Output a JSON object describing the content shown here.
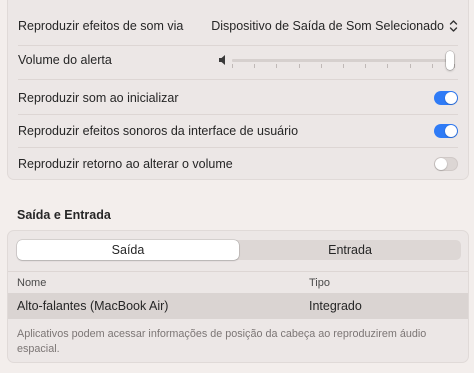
{
  "sound_settings": {
    "play_via_label": "Reproduzir efeitos de som via",
    "play_via_value": "Dispositivo de Saída de Som Selecionado",
    "alert_volume_label": "Volume do alerta",
    "alert_volume_level": 0.98,
    "startup_sound_label": "Reproduzir som ao inicializar",
    "startup_sound_on": true,
    "ui_sounds_label": "Reproduzir efeitos sonoros da interface de usuário",
    "ui_sounds_on": true,
    "volume_feedback_label": "Reproduzir retorno ao alterar o volume",
    "volume_feedback_on": false
  },
  "io_section": {
    "title": "Saída e Entrada",
    "tabs": [
      {
        "label": "Saída",
        "active": true
      },
      {
        "label": "Entrada",
        "active": false
      }
    ],
    "table": {
      "columns": [
        "Nome",
        "Tipo"
      ],
      "rows": [
        {
          "name": "Alto-falantes (MacBook Air)",
          "type": "Integrado",
          "selected": true
        }
      ]
    },
    "note": "Aplicativos podem acessar informações de posição da cabeça ao reproduzirem áudio espacial."
  },
  "colors": {
    "accent": "#2f7bf6",
    "background": "#f3eeec",
    "panel": "#ece7e6"
  }
}
